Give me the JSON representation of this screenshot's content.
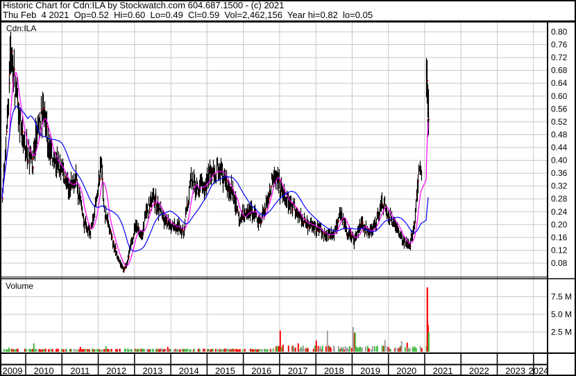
{
  "header": {
    "line1": "Historic Chart for Cdn:ILA by Stockwatch.com 604.687.1500 - (c) 2021",
    "line2": "Thu Feb  4 2021  Op=0.52  Hi=0.60  Lo=0.49  Cl=0.59  Vol=2,462,156  Year hi=0.82  lo=0.05"
  },
  "chart_data": {
    "type": "ohlc",
    "symbol": "Cdn:ILA",
    "volume_title": "Volume",
    "price_ticks": [
      "0.80",
      "0.76",
      "0.72",
      "0.68",
      "0.64",
      "0.60",
      "0.56",
      "0.52",
      "0.48",
      "0.44",
      "0.40",
      "0.36",
      "0.32",
      "0.28",
      "0.24",
      "0.20",
      "0.16",
      "0.12",
      "0.08"
    ],
    "price_range": [
      0.04,
      0.82
    ],
    "volume_ticks": [
      {
        "label": "7.5 M",
        "value": 7.5
      },
      {
        "label": "5.0 M",
        "value": 5.0
      },
      {
        "label": "2.5 M",
        "value": 2.5
      }
    ],
    "volume_range_millions": [
      0,
      10
    ],
    "years": [
      "2009",
      "2010",
      "2011",
      "2012",
      "2013",
      "2014",
      "2015",
      "2016",
      "2017",
      "2018",
      "2019",
      "2020",
      "2021",
      "2022",
      "2023",
      "2024"
    ],
    "close_path": [
      [
        2009.35,
        0.3
      ],
      [
        2009.45,
        0.45
      ],
      [
        2009.58,
        0.75
      ],
      [
        2009.71,
        0.62
      ],
      [
        2009.87,
        0.5
      ],
      [
        2010.06,
        0.42
      ],
      [
        2010.19,
        0.4
      ],
      [
        2010.34,
        0.5
      ],
      [
        2010.48,
        0.55
      ],
      [
        2010.63,
        0.45
      ],
      [
        2010.82,
        0.4
      ],
      [
        2011.01,
        0.36
      ],
      [
        2011.21,
        0.31
      ],
      [
        2011.4,
        0.34
      ],
      [
        2011.59,
        0.21
      ],
      [
        2011.78,
        0.17
      ],
      [
        2011.97,
        0.3
      ],
      [
        2012.07,
        0.4
      ],
      [
        2012.16,
        0.25
      ],
      [
        2012.35,
        0.16
      ],
      [
        2012.54,
        0.09
      ],
      [
        2012.7,
        0.06
      ],
      [
        2012.83,
        0.1
      ],
      [
        2013.02,
        0.2
      ],
      [
        2013.21,
        0.16
      ],
      [
        2013.31,
        0.24
      ],
      [
        2013.5,
        0.28
      ],
      [
        2013.69,
        0.25
      ],
      [
        2013.88,
        0.2
      ],
      [
        2014.07,
        0.2
      ],
      [
        2014.36,
        0.18
      ],
      [
        2014.55,
        0.34
      ],
      [
        2014.74,
        0.3
      ],
      [
        2014.94,
        0.33
      ],
      [
        2015.13,
        0.36
      ],
      [
        2015.32,
        0.37
      ],
      [
        2015.51,
        0.33
      ],
      [
        2015.7,
        0.3
      ],
      [
        2015.89,
        0.21
      ],
      [
        2016.08,
        0.25
      ],
      [
        2016.27,
        0.24
      ],
      [
        2016.47,
        0.21
      ],
      [
        2016.66,
        0.28
      ],
      [
        2016.85,
        0.37
      ],
      [
        2017.04,
        0.3
      ],
      [
        2017.23,
        0.27
      ],
      [
        2017.42,
        0.25
      ],
      [
        2017.61,
        0.21
      ],
      [
        2017.9,
        0.2
      ],
      [
        2018.19,
        0.17
      ],
      [
        2018.48,
        0.17
      ],
      [
        2018.67,
        0.24
      ],
      [
        2018.86,
        0.18
      ],
      [
        2019.05,
        0.15
      ],
      [
        2019.24,
        0.2
      ],
      [
        2019.43,
        0.18
      ],
      [
        2019.62,
        0.2
      ],
      [
        2019.81,
        0.27
      ],
      [
        2020.01,
        0.23
      ],
      [
        2020.2,
        0.19
      ],
      [
        2020.39,
        0.15
      ],
      [
        2020.58,
        0.13
      ],
      [
        2020.71,
        0.2
      ],
      [
        2020.83,
        0.38
      ],
      [
        2020.9,
        0.34
      ]
    ],
    "final_segment": [
      [
        2021.04,
        0.62
      ],
      [
        2021.06,
        0.68
      ],
      [
        2021.08,
        0.52
      ],
      [
        2021.1,
        0.59
      ]
    ],
    "volume_spikes_millions": [
      [
        2009.52,
        0.3
      ],
      [
        2010.2,
        0.9
      ],
      [
        2011.5,
        0.4
      ],
      [
        2012.2,
        0.5
      ],
      [
        2013.9,
        0.4
      ],
      [
        2017.0,
        2.7
      ],
      [
        2017.08,
        0.7
      ],
      [
        2017.5,
        0.9
      ],
      [
        2018.3,
        2.7
      ],
      [
        2018.0,
        1.3
      ],
      [
        2019.0,
        3.2
      ],
      [
        2019.05,
        2.4
      ],
      [
        2019.9,
        1.4
      ],
      [
        2020.35,
        1.2
      ],
      [
        2020.5,
        1.0
      ],
      [
        2021.06,
        8.8
      ],
      [
        2021.08,
        3.5
      ],
      [
        2021.1,
        2.46
      ]
    ],
    "moving_averages": [
      {
        "name": "short",
        "color": "#ff00ff"
      },
      {
        "name": "long",
        "color": "#0000ff"
      }
    ]
  },
  "colors": {
    "bar": "#000000",
    "close_tick": "#ff0000",
    "vol_up": "#44bb44",
    "vol_down": "#ff0000",
    "vol_flat": "#a0a0a0",
    "grid": "#c8c8c8"
  }
}
